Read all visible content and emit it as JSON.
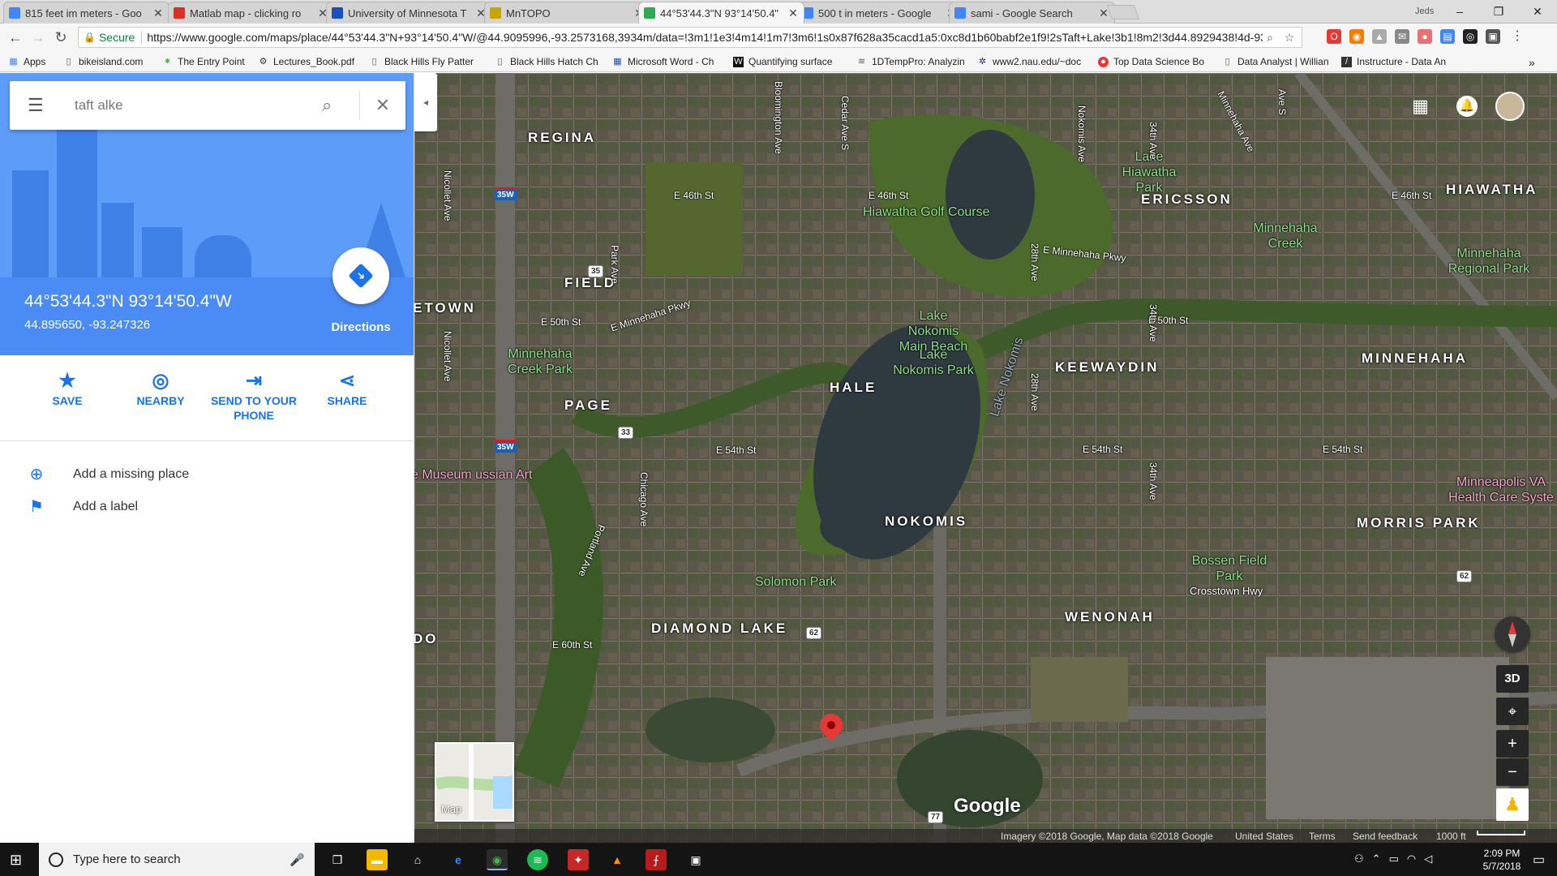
{
  "browser": {
    "tabs": [
      {
        "title": "815 feet im meters - Goo",
        "favicon": "google-icon",
        "color": "#4285f4"
      },
      {
        "title": "Matlab map - clicking ro",
        "favicon": "gmail-icon",
        "color": "#d93025"
      },
      {
        "title": "University of Minnesota T",
        "favicon": "umn-icon",
        "color": "#1a4fba"
      },
      {
        "title": "MnTOPO",
        "favicon": "mntopo-icon",
        "color": "#c9a400"
      },
      {
        "title": "44°53'44.3\"N 93°14'50.4\"",
        "favicon": "maps-icon",
        "color": "#34a853",
        "active": true
      },
      {
        "title": "500 t in meters - Google",
        "favicon": "google-icon",
        "color": "#4285f4"
      },
      {
        "title": "sami - Google Search",
        "favicon": "google-icon",
        "color": "#4285f4"
      }
    ],
    "window_user": "Jeds",
    "window_controls": [
      "–",
      "❐",
      "✕"
    ],
    "secure_label": "Secure",
    "url": "https://www.google.com/maps/place/44°53'44.3\"N+93°14'50.4\"W/@44.9095996,-93.2573168,3934m/data=!3m1!1e3!4m14!1m7!3m6!1s0x87f628a35cacd1a5:0xc8d1b60babf2e1f9!2sTaft+Lake!3b1!8m2!3d44.8929438!4d-93.2...",
    "bookmarks": [
      {
        "label": "Apps",
        "icon": "apps-grid-icon"
      },
      {
        "label": "bikeisland.com",
        "icon": "page-icon"
      },
      {
        "label": "The Entry Point",
        "icon": "leaf-icon"
      },
      {
        "label": "Lectures_Book.pdf",
        "icon": "gear-icon"
      },
      {
        "label": "Black Hills Fly Patter",
        "icon": "page-icon"
      },
      {
        "label": "Black Hills Hatch Ch",
        "icon": "page-icon"
      },
      {
        "label": "Microsoft Word - Ch",
        "icon": "grid-icon"
      },
      {
        "label": "Quantifying surface",
        "icon": "w-icon"
      },
      {
        "label": "1DTempPro: Analyzin",
        "icon": "chart-icon"
      },
      {
        "label": "www2.nau.edu/~doc",
        "icon": "nau-icon"
      },
      {
        "label": "Top Data Science Bo",
        "icon": "red-icon"
      },
      {
        "label": "Data Analyst | Willian",
        "icon": "page-icon"
      },
      {
        "label": "Instructure - Data An",
        "icon": "slash-icon"
      }
    ]
  },
  "panel": {
    "search_value": "taft alke",
    "coord_title": "44°53'44.3\"N 93°14'50.4\"W",
    "coord_decimal": "44.895650, -93.247326",
    "directions_label": "Directions",
    "actions": [
      {
        "label": "SAVE",
        "icon": "star-icon"
      },
      {
        "label": "NEARBY",
        "icon": "nearby-icon"
      },
      {
        "label": "SEND TO YOUR PHONE",
        "icon": "send-to-phone-icon"
      },
      {
        "label": "SHARE",
        "icon": "share-icon"
      }
    ],
    "options": [
      {
        "label": "Add a missing place",
        "icon": "add-place-icon"
      },
      {
        "label": "Add a label",
        "icon": "flag-icon"
      }
    ]
  },
  "map": {
    "neighborhoods": [
      "REGINA",
      "FIELD",
      "ETOWN",
      "PAGE",
      "HALE",
      "NOKOMIS",
      "DIAMOND LAKE",
      "ERICSSON",
      "KEEWAYDIN",
      "HIAWATHA",
      "MINNEHAHA",
      "MORRIS PARK",
      "WENONAH",
      "DO"
    ],
    "parks": [
      "Lake Hiawatha Park",
      "Hiawatha Golf Course",
      "Minnehaha Creek",
      "Minnehaha Regional Park",
      "Lake Nokomis Main Beach",
      "Lake Nokomis Park",
      "Minnehaha Creek Park",
      "Solomon Park",
      "Bossen Field Park"
    ],
    "lake_label": "Lake Nokomis",
    "places": [
      "e Museum ussian Art",
      "Minneapolis VA Health Care Syste"
    ],
    "streets": [
      "E 46th St",
      "E 46th St",
      "E 46th St",
      "E Minnehaha Pkwy",
      "E Minnehaha Pkwy",
      "E 50th St",
      "E 50th St",
      "E 54th St",
      "E 54th St",
      "E 54th St",
      "E 60th St",
      "Crosstown Hwy"
    ],
    "vstreets": [
      "Nicollet Ave",
      "Nicollet Ave",
      "Park Ave",
      "Chicago Ave",
      "Portland Ave",
      "Bloomington Ave",
      "Cedar Ave S",
      "Nokomis Ave",
      "28th Ave",
      "28th Ave",
      "34th Ave",
      "34th Ave",
      "34th Ave",
      "Minnehaha Ave",
      "Ave S"
    ],
    "shields": [
      "35W",
      "35W",
      "35",
      "33",
      "62",
      "62",
      "77"
    ],
    "minimap_label": "Map",
    "three_d_label": "3D",
    "zoom_in": "+",
    "zoom_out": "−",
    "logo": "Google",
    "attribution": {
      "imagery": "Imagery ©2018 Google, Map data ©2018 Google",
      "country": "United States",
      "terms": "Terms",
      "feedback": "Send feedback",
      "scale": "1000 ft"
    },
    "colors": {
      "lake": "#2f3a40",
      "green": "#4b6a2c",
      "urban": "#5d5a4c"
    }
  },
  "taskbar": {
    "search_placeholder": "Type here to search",
    "time": "2:09 PM",
    "date": "5/7/2018",
    "apps": [
      "task-view-icon",
      "file-explorer-icon",
      "home-icon",
      "edge-icon",
      "chrome-icon",
      "spotify-icon",
      "app-red-icon",
      "matlab-icon",
      "acrobat-icon",
      "photos-icon"
    ]
  }
}
